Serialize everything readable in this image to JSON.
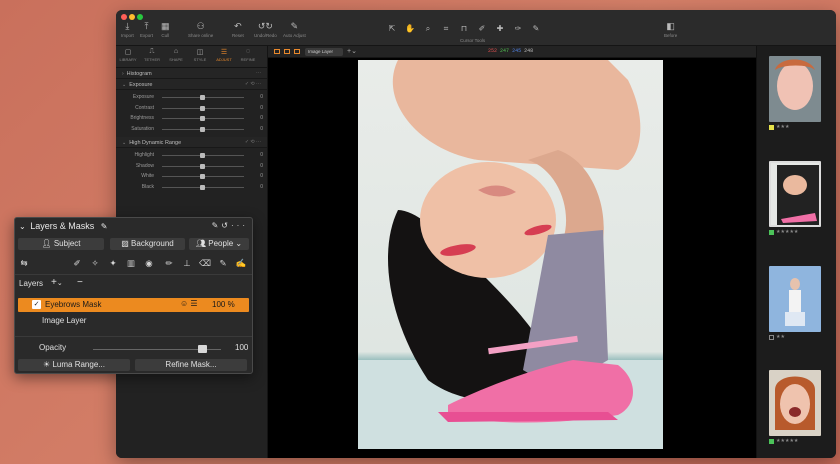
{
  "toolbar": {
    "items": [
      {
        "label": "Import",
        "icon": "import-icon"
      },
      {
        "label": "Export",
        "icon": "export-icon"
      },
      {
        "label": "Cull",
        "icon": "cull-icon"
      },
      {
        "label": "Share online",
        "icon": "share-icon"
      },
      {
        "label": "Reset",
        "icon": "reset-icon"
      },
      {
        "label": "Undo/Redo",
        "icon": "undo-icon"
      },
      {
        "label": "Auto Adjust",
        "icon": "wand-icon"
      },
      {
        "label": "Before",
        "icon": "before-after-icon"
      }
    ],
    "cursor_tools_label": "Cursor Tools"
  },
  "tool_tabs": [
    {
      "label": "LIBRARY"
    },
    {
      "label": "TETHER"
    },
    {
      "label": "SHAPE"
    },
    {
      "label": "STYLE"
    },
    {
      "label": "ADJUST",
      "active": true
    },
    {
      "label": "REFINE"
    }
  ],
  "panels": {
    "histogram": "Histogram",
    "exposure": {
      "title": "Exposure",
      "sliders": [
        {
          "label": "Exposure",
          "value": "0"
        },
        {
          "label": "Contrast",
          "value": "0"
        },
        {
          "label": "Brightness",
          "value": "0"
        },
        {
          "label": "Saturation",
          "value": "0"
        }
      ]
    },
    "hdr": {
      "title": "High Dynamic Range",
      "sliders": [
        {
          "label": "Highlight",
          "value": "0"
        },
        {
          "label": "Shadow",
          "value": "0"
        },
        {
          "label": "White",
          "value": "0"
        },
        {
          "label": "Black",
          "value": "0"
        }
      ]
    }
  },
  "viewer": {
    "layer_select": "Image Layer",
    "rgb": {
      "r": "252",
      "g": "247",
      "b": "245",
      "a": "248"
    }
  },
  "browser": {
    "thumbs": [
      {
        "tag_color": "#e6e24a",
        "stars": "★★★"
      },
      {
        "tag_color": "#4cc35a",
        "stars": "★★★★★"
      },
      {
        "tag_color": "",
        "stars": "★★"
      },
      {
        "tag_color": "#4cc35a",
        "stars": "★★★★★"
      }
    ]
  },
  "layers_masks": {
    "title": "Layers & Masks",
    "buttons": {
      "subject": "Subject",
      "background": "Background",
      "people": "People"
    },
    "layers_label": "Layers",
    "layers": [
      {
        "name": "Eyebrows Mask",
        "opacity": "100 %",
        "selected": true
      },
      {
        "name": "Image Layer",
        "selected": false
      }
    ],
    "opacity_label": "Opacity",
    "opacity_value": "100",
    "opacity_level": 0.85,
    "luma_range": "Luma Range...",
    "refine_mask": "Refine Mask..."
  },
  "colors": {
    "accent": "#ec8a1f",
    "bg": "#1e1e1e"
  }
}
